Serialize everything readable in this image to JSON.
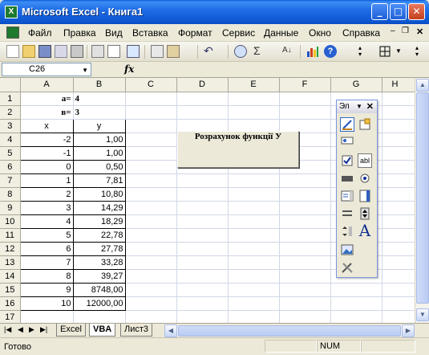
{
  "window": {
    "title": "Microsoft Excel - Книга1"
  },
  "menu": [
    "Файл",
    "Правка",
    "Вид",
    "Вставка",
    "Формат",
    "Сервис",
    "Данные",
    "Окно",
    "Справка"
  ],
  "formula_bar": {
    "name_box": "C26",
    "fx": "fx",
    "value": ""
  },
  "columns": [
    "A",
    "B",
    "C",
    "D",
    "E",
    "F",
    "G",
    "H"
  ],
  "rows": [
    {
      "n": "1",
      "a": "a=",
      "b": "4"
    },
    {
      "n": "2",
      "a": "в=",
      "b": "3"
    },
    {
      "n": "3",
      "a": "x",
      "b": "y"
    },
    {
      "n": "4",
      "a": "-2",
      "b": "1,00"
    },
    {
      "n": "5",
      "a": "-1",
      "b": "1,00"
    },
    {
      "n": "6",
      "a": "0",
      "b": "0,50"
    },
    {
      "n": "7",
      "a": "1",
      "b": "7,81"
    },
    {
      "n": "8",
      "a": "2",
      "b": "10,80"
    },
    {
      "n": "9",
      "a": "3",
      "b": "14,29"
    },
    {
      "n": "10",
      "a": "4",
      "b": "18,29"
    },
    {
      "n": "11",
      "a": "5",
      "b": "22,78"
    },
    {
      "n": "12",
      "a": "6",
      "b": "27,78"
    },
    {
      "n": "13",
      "a": "7",
      "b": "33,28"
    },
    {
      "n": "14",
      "a": "8",
      "b": "39,27"
    },
    {
      "n": "15",
      "a": "9",
      "b": "8748,00"
    },
    {
      "n": "16",
      "a": "10",
      "b": "12000,00"
    },
    {
      "n": "17",
      "a": "",
      "b": ""
    }
  ],
  "macro_button": {
    "label": "Розрахунок функції У"
  },
  "toolbox": {
    "title": "Эл"
  },
  "sheet_tabs": [
    "Excel",
    "VBA",
    "Лист3"
  ],
  "active_tab": "VBA",
  "status": {
    "left": "Готово",
    "num": "NUM"
  }
}
